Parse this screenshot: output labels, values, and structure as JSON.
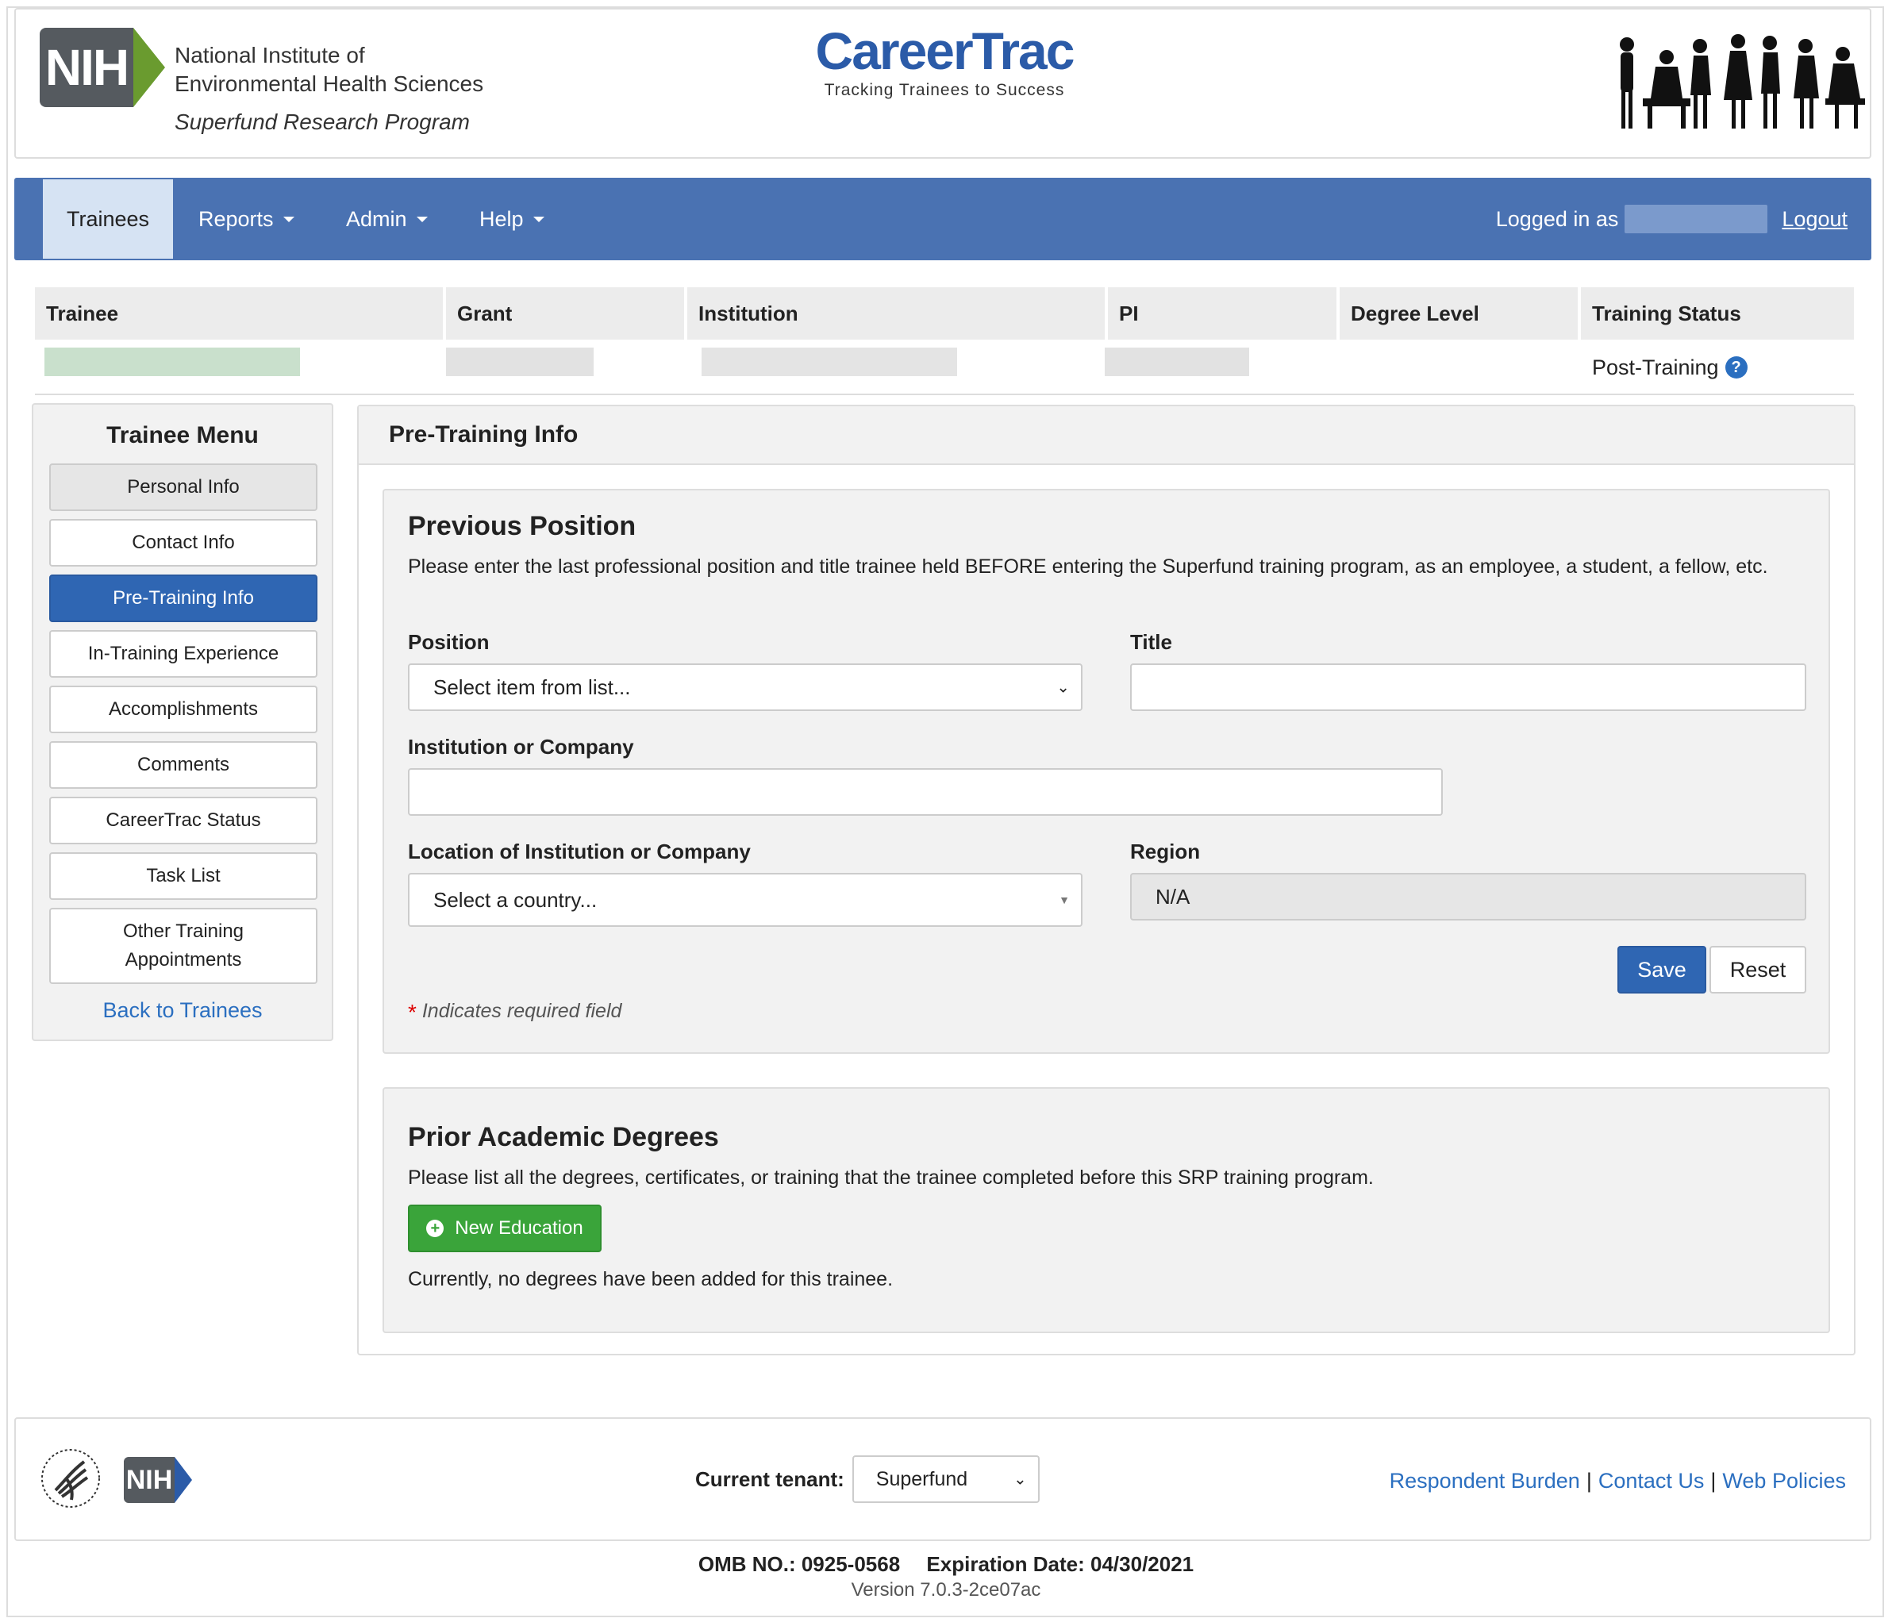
{
  "header": {
    "logo_text": "NIH",
    "org_line1": "National Institute of",
    "org_line2": "Environmental Health Sciences",
    "program": "Superfund Research Program",
    "brand_title": "CareerTrac",
    "brand_tagline": "Tracking Trainees to Success"
  },
  "nav": {
    "items": [
      {
        "label": "Trainees",
        "active": true
      },
      {
        "label": "Reports",
        "dropdown": true
      },
      {
        "label": "Admin",
        "dropdown": true
      },
      {
        "label": "Help",
        "dropdown": true
      }
    ],
    "logged_in_label": "Logged in as",
    "logout_label": "Logout"
  },
  "trainee_table": {
    "headers": [
      "Trainee",
      "Grant",
      "Institution",
      "PI",
      "Degree Level",
      "Training Status"
    ],
    "training_status": "Post-Training",
    "help_icon": "question-circle-icon"
  },
  "sidebar": {
    "title": "Trainee Menu",
    "items": [
      {
        "label": "Personal Info"
      },
      {
        "label": "Contact Info"
      },
      {
        "label": "Pre-Training Info",
        "current": true
      },
      {
        "label": "In-Training Experience"
      },
      {
        "label": "Accomplishments"
      },
      {
        "label": "Comments"
      },
      {
        "label": "CareerTrac Status"
      },
      {
        "label": "Task List"
      },
      {
        "label": "Other Training Appointments"
      }
    ],
    "back_link": "Back to Trainees"
  },
  "main": {
    "heading": "Pre-Training Info",
    "previous_position": {
      "title": "Previous Position",
      "description": "Please enter the last professional position and title trainee held BEFORE entering the Superfund training program, as an employee, a student, a fellow, etc.",
      "position_label": "Position",
      "position_value": "Select item from list...",
      "title_label": "Title",
      "title_value": "",
      "institution_label": "Institution or Company",
      "institution_value": "",
      "location_label": "Location of Institution or Company",
      "location_value": "Select a country...",
      "region_label": "Region",
      "region_value": "N/A",
      "save_label": "Save",
      "reset_label": "Reset",
      "required_star": "*",
      "required_note": "Indicates required field"
    },
    "prior_degrees": {
      "title": "Prior Academic Degrees",
      "description": "Please list all the degrees, certificates, or training that the trainee completed before this SRP training program.",
      "new_button": "New Education",
      "empty_message": "Currently, no degrees have been added for this trainee."
    }
  },
  "footer": {
    "nih_text": "NIH",
    "tenant_label": "Current tenant:",
    "tenant_value": "Superfund",
    "links": [
      "Respondent Burden",
      "Contact Us",
      "Web Policies"
    ],
    "omb": "OMB NO.: 0925-0568",
    "expiration": "Expiration Date: 04/30/2021",
    "version": "Version 7.0.3-2ce07ac"
  },
  "colors": {
    "nav_bg": "#4a72b2",
    "primary": "#2f66b3",
    "success": "#3aa43a",
    "link": "#2b6fc0"
  }
}
